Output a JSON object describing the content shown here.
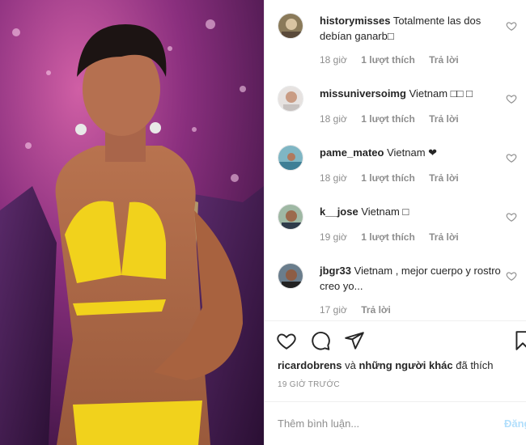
{
  "post": {
    "image_alt_icon": "post-photo"
  },
  "comments": [
    {
      "username": "historymisses",
      "text": "Totalmente las dos debían ganarb□",
      "time": "18 giờ",
      "likes": "1 lượt thích",
      "reply": "Trả lời"
    },
    {
      "username": "missuniversoimg",
      "text": "Vietnam □□ □",
      "time": "18 giờ",
      "likes": "1 lượt thích",
      "reply": "Trả lời"
    },
    {
      "username": "pame_mateo",
      "text": "Vietnam ❤",
      "time": "18 giờ",
      "likes": "1 lượt thích",
      "reply": "Trả lời"
    },
    {
      "username": "k__jose",
      "text": "Vietnam □",
      "time": "19 giờ",
      "likes": "1 lượt thích",
      "reply": "Trả lời"
    },
    {
      "username": "jbgr33",
      "text": "Vietnam , mejor cuerpo y rostro creo yo...",
      "time": "17 giờ",
      "likes": "",
      "reply": "Trả lời"
    }
  ],
  "actions": {
    "like_icon": "heart-icon",
    "comment_icon": "comment-icon",
    "share_icon": "share-icon",
    "save_icon": "bookmark-icon"
  },
  "likes_summary": {
    "user": "ricardobrens",
    "connector": " và ",
    "others": "những người khác",
    "suffix": " đã thích"
  },
  "time_ago": "19 GIỜ TRƯỚC",
  "add_comment": {
    "placeholder": "Thêm bình luận...",
    "post_label": "Đăng"
  },
  "colors": {
    "text": "#262626",
    "muted": "#8e8e8e",
    "post_disabled": "#b2dffc"
  }
}
